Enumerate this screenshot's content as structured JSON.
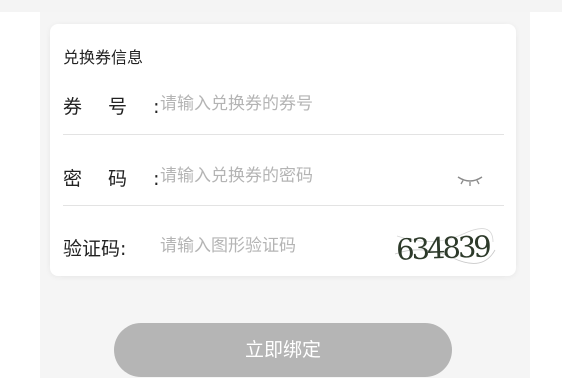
{
  "card": {
    "title": "兑换券信息"
  },
  "coupon_number": {
    "label": "券 号 :",
    "placeholder": "请输入兑换券的券号"
  },
  "password": {
    "label": "密 码 :",
    "placeholder": "请输入兑换券的密码",
    "toggle_icon": "eye-closed-icon"
  },
  "captcha": {
    "label": "验证码:",
    "placeholder": "请输入图形验证码",
    "image_text": "634839"
  },
  "submit": {
    "label": "立即绑定",
    "color": "#b5b5b5"
  }
}
